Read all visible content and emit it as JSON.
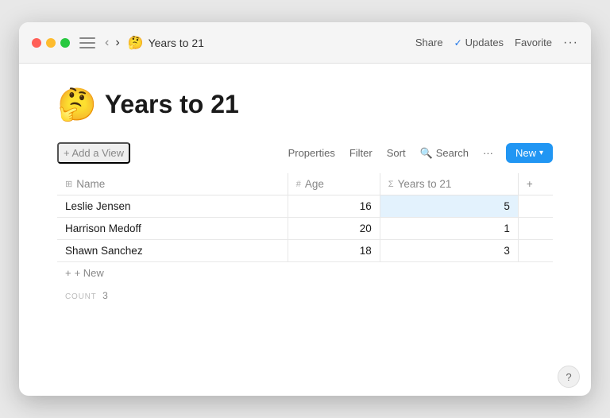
{
  "titlebar": {
    "page_title": "Years to 21",
    "page_emoji": "🤔",
    "share_label": "Share",
    "updates_label": "Updates",
    "favorite_label": "Favorite"
  },
  "toolbar": {
    "add_view_label": "+ Add a View",
    "properties_label": "Properties",
    "filter_label": "Filter",
    "sort_label": "Sort",
    "search_label": "Search",
    "new_label": "New"
  },
  "table": {
    "col_name": "Name",
    "col_age": "Age",
    "col_years": "Years to 21",
    "rows": [
      {
        "name": "Leslie Jensen",
        "age": 16,
        "years_to_21": 5
      },
      {
        "name": "Harrison Medoff",
        "age": 20,
        "years_to_21": 1
      },
      {
        "name": "Shawn Sanchez",
        "age": 18,
        "years_to_21": 3
      }
    ],
    "new_row_label": "+ New",
    "count_label": "COUNT",
    "count_value": "3"
  },
  "help": {
    "label": "?"
  }
}
